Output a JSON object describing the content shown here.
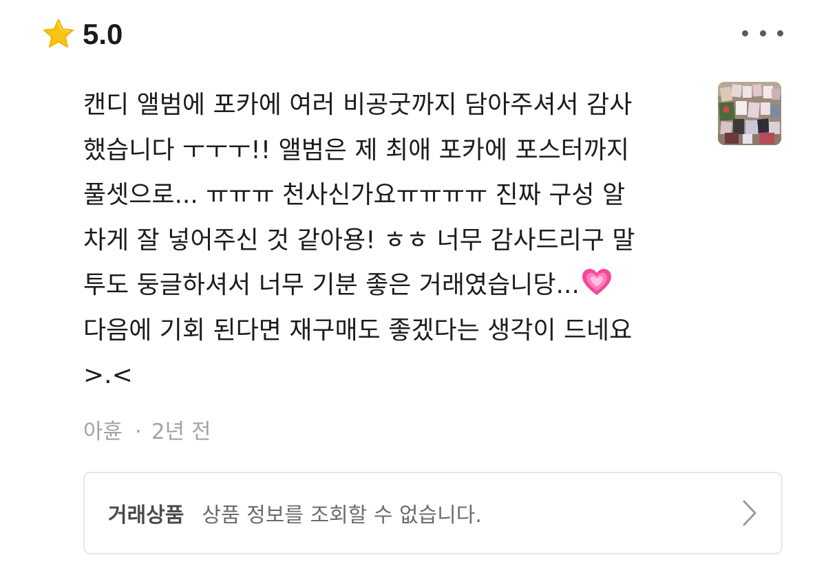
{
  "rating": {
    "value": "5.0",
    "icon": "star-icon",
    "icon_color": "#F9C414"
  },
  "menu": {
    "icon": "more-horizontal-icon"
  },
  "review": {
    "lines": [
      "캔디 앨범에 포카에 여러 비공굿까지 담아주셔서 감사",
      "했습니다 ㅜㅜㅜ!! 앨범은 제 최애 포카에 포스터까지",
      "풀셋으로... ㅠㅠㅠ 천사신가요ㅠㅠㅠㅠ 진짜 구성 알",
      "차게 잘 넣어주신 것 같아용! ㅎㅎ 너무 감사드리구 말",
      "투도 둥글하셔서 너무 기분 좋은 거래였습니당...",
      "다음에 기회 된다면 재구매도 좋겠다는 생각이 드네요",
      ">.<"
    ],
    "emoji_icon": "growing-heart-icon",
    "heart_color": "#F5479A"
  },
  "meta": {
    "author": "아휸",
    "separator": "·",
    "time_ago": "2년 전"
  },
  "thumbnail": {
    "icon": "photo-thumbnail"
  },
  "product": {
    "label": "거래상품",
    "info": "상품 정보를 조회할 수 없습니다.",
    "icon": "chevron-right-icon"
  }
}
